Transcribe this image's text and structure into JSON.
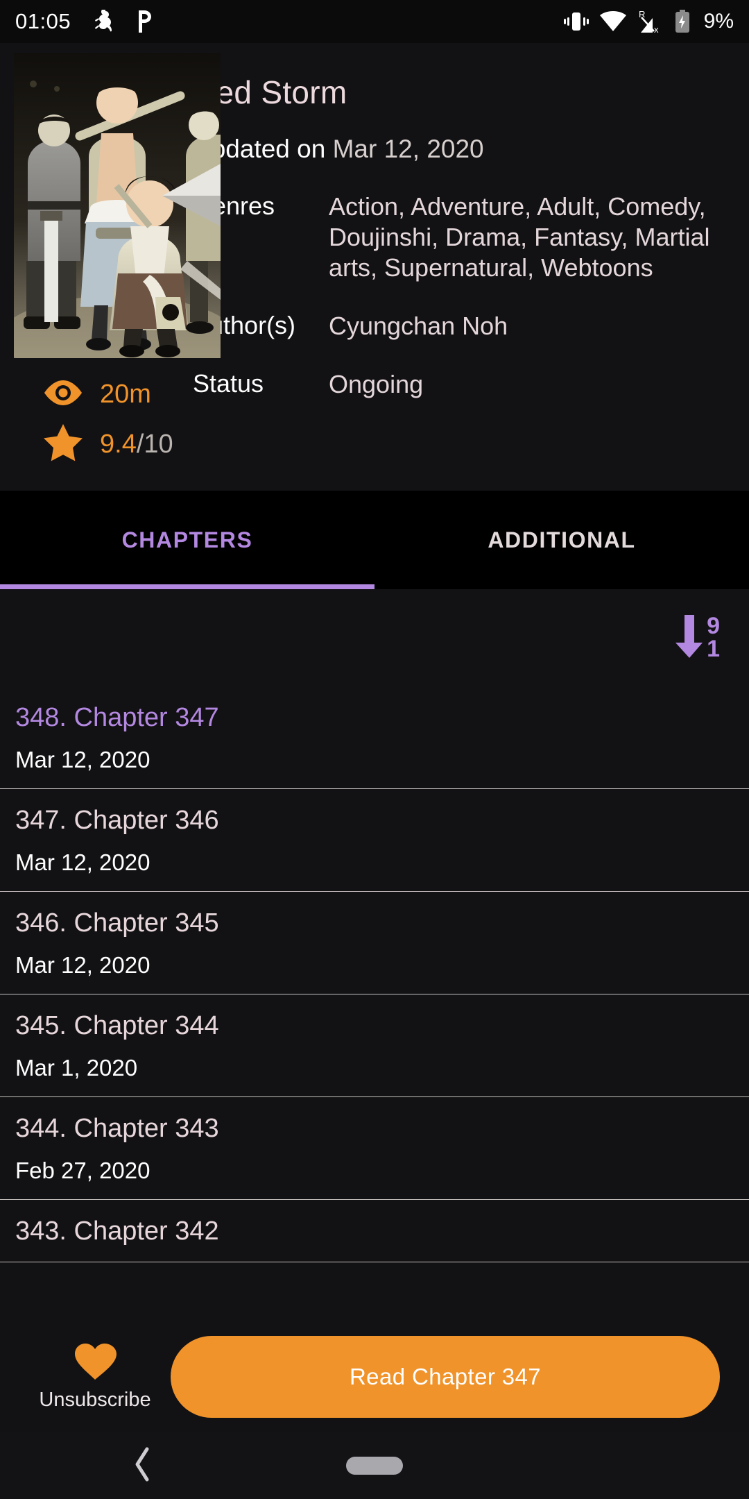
{
  "status_bar": {
    "time": "01:05",
    "battery_percent": "9%",
    "icons": [
      "ant-app-icon",
      "p-app-icon",
      "vibrate-icon",
      "wifi-icon",
      "cellular-roaming-no-signal-icon",
      "battery-charging-icon"
    ]
  },
  "header": {
    "title": "Red Storm",
    "updated_label": "Updated on",
    "updated_date": "Mar 12, 2020",
    "fields": [
      {
        "key": "Genres",
        "value": "Action, Adventure, Adult, Comedy, Doujinshi, Drama, Fantasy, Martial arts, Supernatural, Webtoons"
      },
      {
        "key": "Author(s)",
        "value": "Cyungchan Noh"
      },
      {
        "key": "Status",
        "value": "Ongoing"
      }
    ],
    "stats": {
      "views": "20m",
      "rating": "9.4",
      "rating_denominator": "/10"
    },
    "accent_orange": "#f0932a",
    "accent_purple": "#b388e0"
  },
  "tabs": [
    {
      "label": "CHAPTERS",
      "active": true
    },
    {
      "label": "ADDITIONAL",
      "active": false
    }
  ],
  "sort": {
    "icon": "sort-descending-numeric-icon",
    "top_digit": "9",
    "bottom_digit": "1"
  },
  "chapters": [
    {
      "title": "348. Chapter 347",
      "date": "Mar 12, 2020",
      "current": true
    },
    {
      "title": "347. Chapter 346",
      "date": "Mar 12, 2020",
      "current": false
    },
    {
      "title": "346. Chapter 345",
      "date": "Mar 12, 2020",
      "current": false
    },
    {
      "title": "345. Chapter 344",
      "date": "Mar 1, 2020",
      "current": false
    },
    {
      "title": "344. Chapter 343",
      "date": "Feb 27, 2020",
      "current": false
    },
    {
      "title": "343. Chapter 342",
      "date": "",
      "current": false
    }
  ],
  "bottom_bar": {
    "subscribe_label": "Unsubscribe",
    "subscribe_icon": "heart-filled-icon",
    "read_button_label": "Read Chapter 347"
  },
  "nav_bar": {
    "back_icon": "back-chevron-icon",
    "home_icon": "home-pill-icon"
  }
}
